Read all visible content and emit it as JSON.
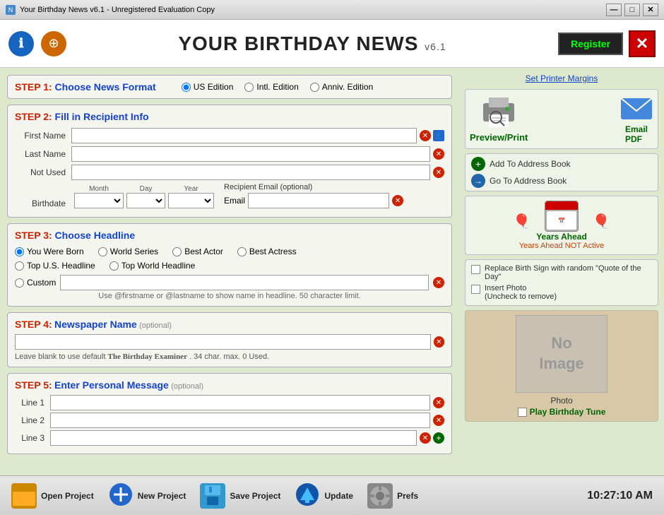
{
  "titlebar": {
    "title": "Your Birthday News v6.1 - Unregistered Evaluation Copy",
    "min": "—",
    "max": "□",
    "close": "✕"
  },
  "header": {
    "title": "YOUR BIRTHDAY NEWS",
    "version": "v6.1",
    "register_label": "Register"
  },
  "step1": {
    "label": "STEP 1:",
    "title": "Choose News Format",
    "options": [
      "US Edition",
      "Intl. Edition",
      "Anniv. Edition"
    ]
  },
  "step2": {
    "label": "STEP 2:",
    "title": "Fill in Recipient Info",
    "fields": {
      "first_name": "First Name",
      "last_name": "Last Name",
      "not_used": "Not Used"
    },
    "birthdate": {
      "label": "Birthdate",
      "month_label": "Month",
      "day_label": "Day",
      "year_label": "Year"
    },
    "email_label": "Recipient Email (optional)",
    "email_field_label": "Email"
  },
  "step3": {
    "label": "STEP 3:",
    "title": "Choose Headline",
    "options": [
      "You Were Born",
      "World Series",
      "Best Actor",
      "Best Actress",
      "Top U.S. Headline",
      "Top World Headline",
      "Custom"
    ],
    "hint": "Use @firstname or @lastname to show name in headline. 50 character limit."
  },
  "step4": {
    "label": "STEP 4:",
    "title": "Newspaper Name",
    "optional": "(optional)",
    "hint_prefix": "Leave blank to use default",
    "default_name": "The Birthday Examiner",
    "hint_suffix": ". 34 char. max. 0 Used."
  },
  "step5": {
    "label": "STEP 5:",
    "title": "Enter Personal Message",
    "optional": "(optional)",
    "lines": [
      "Line 1",
      "Line 2",
      "Line 3"
    ]
  },
  "right_panel": {
    "printer_margins": "Set Printer Margins",
    "preview_label": "Preview/Print",
    "email_label": "Email\nPDF",
    "add_address": "Add To Address Book",
    "go_address": "Go To Address Book",
    "years_ahead": "Years Ahead",
    "years_status": "Years Ahead NOT Active",
    "option1": "Replace Birth Sign with random \"Quote of the Day\"",
    "option2": "Insert Photo\n(Uncheck to remove)",
    "photo_text1": "No",
    "photo_text2": "Image",
    "photo_text3": "Photo",
    "photo_label": "Photo",
    "tune_label": "Play Birthday Tune"
  },
  "toolbar": {
    "open_label": "Open Project",
    "new_label": "New Project",
    "save_label": "Save Project",
    "update_label": "Update",
    "prefs_label": "Prefs",
    "clock": "10:27:10 AM"
  },
  "icons": {
    "info": "ℹ",
    "help": "?",
    "close": "✕",
    "folder": "📁",
    "new_plus": "+",
    "save": "💾",
    "download": "↓",
    "wrench": "🔧"
  }
}
